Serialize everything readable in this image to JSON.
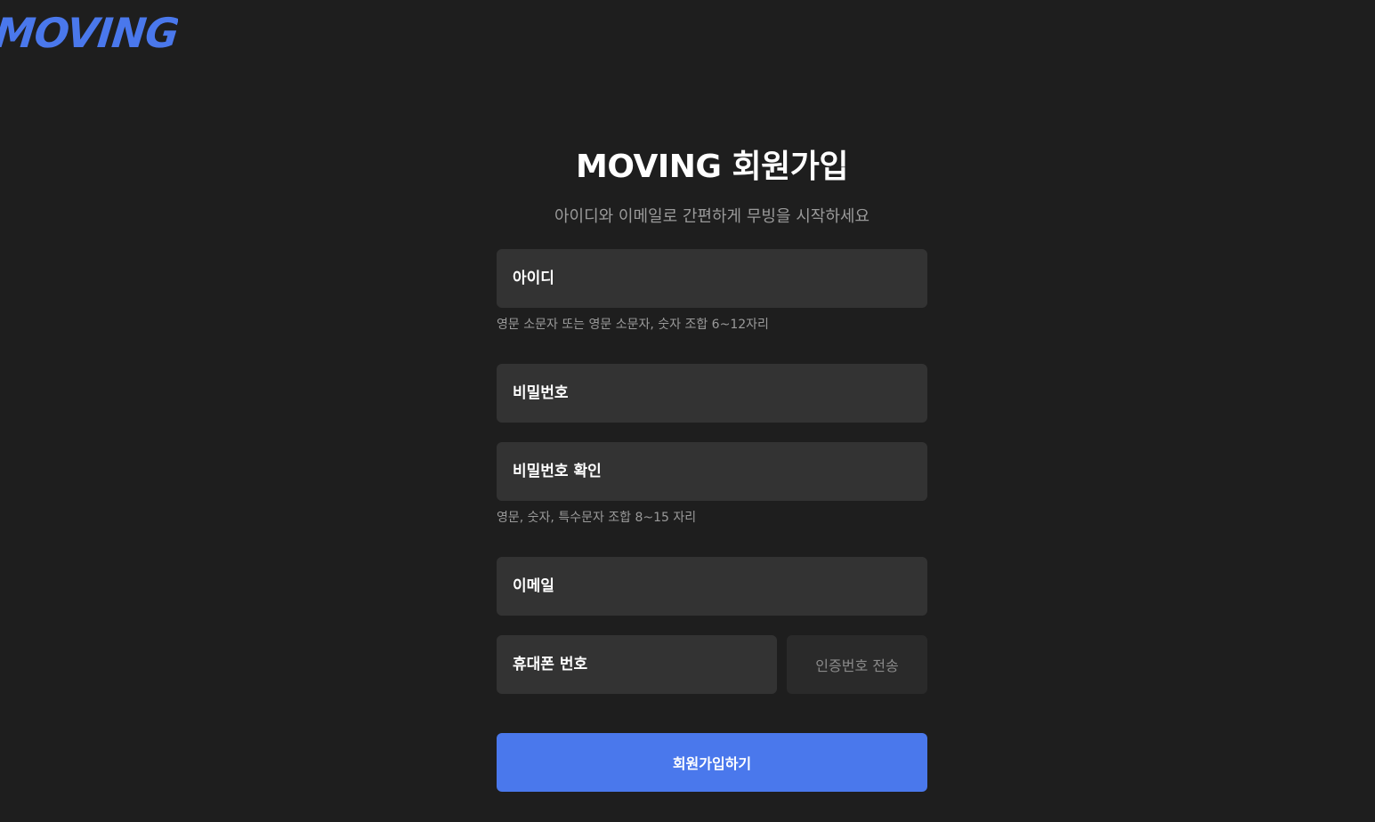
{
  "logo": {
    "text": "MOVING"
  },
  "signup": {
    "title": "MOVING 회원가입",
    "subtitle": "아이디와 이메일로 간편하게 무빙을 시작하세요",
    "fields": {
      "username": {
        "value": "",
        "placeholder": "아이디",
        "hint": "영문 소문자 또는 영문 소문자, 숫자 조합 6~12자리"
      },
      "password": {
        "value": "",
        "placeholder": "비밀번호"
      },
      "password_confirm": {
        "value": "",
        "placeholder": "비밀번호 확인",
        "hint": "영문, 숫자, 특수문자 조합 8~15 자리"
      },
      "email": {
        "value": "",
        "placeholder": "이메일"
      },
      "phone": {
        "value": "",
        "placeholder": "휴대폰 번호"
      }
    },
    "send_code_label": "인증번호 전송",
    "submit_label": "회원가입하기"
  },
  "colors": {
    "background": "#1e1e1e",
    "field_background": "#333333",
    "accent": "#4a78ec",
    "muted_text": "#9a9a9a"
  }
}
